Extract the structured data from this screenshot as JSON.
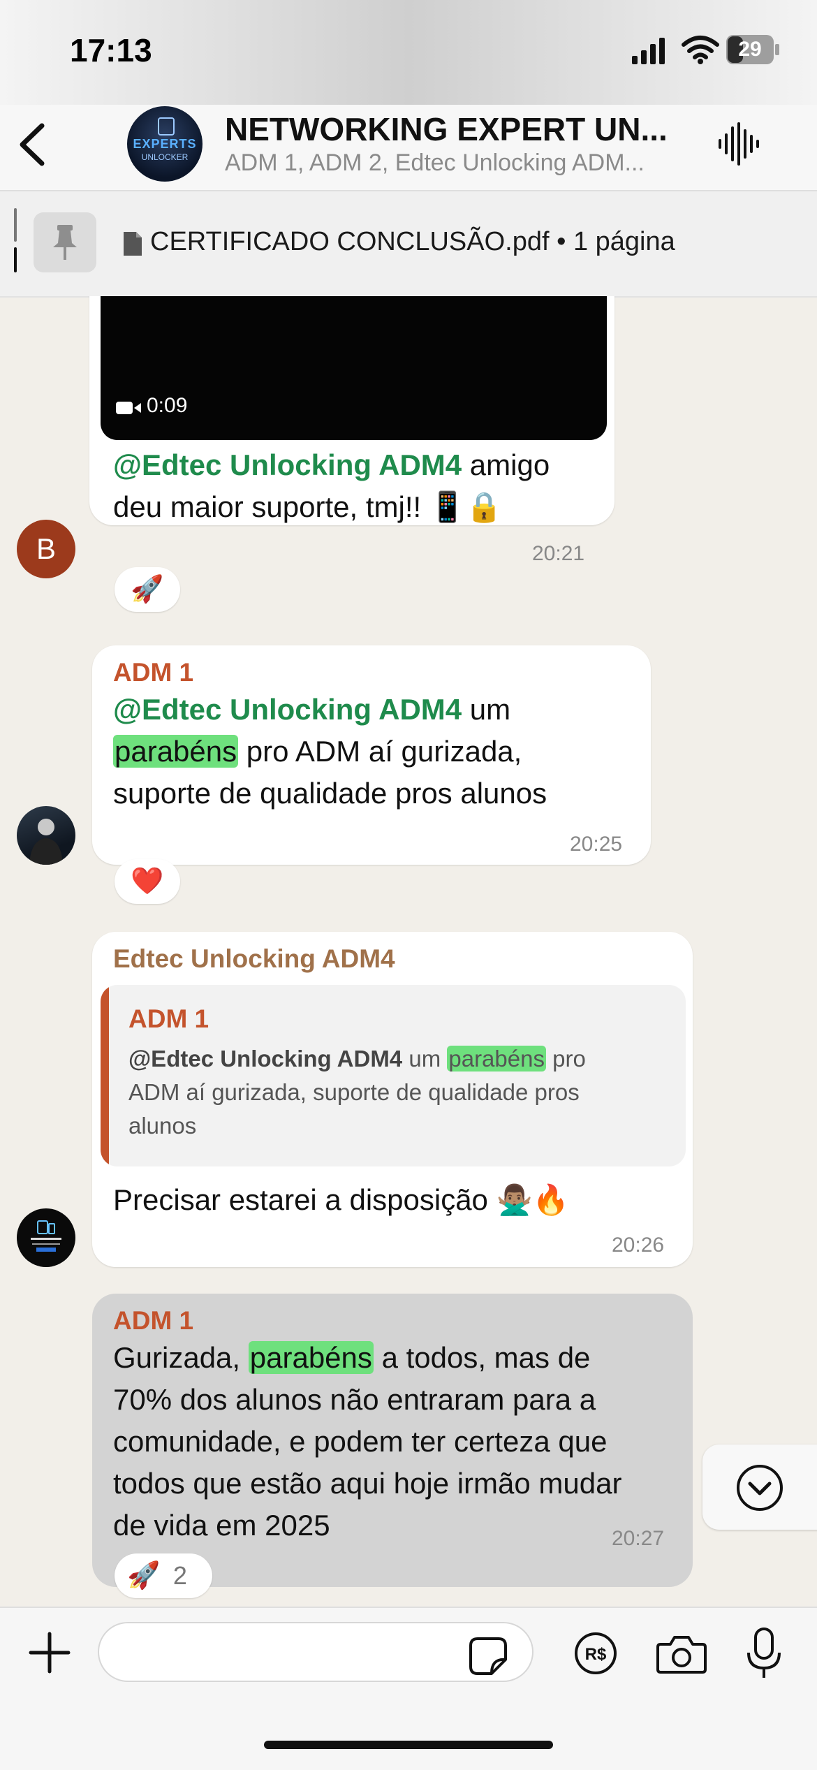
{
  "status_bar": {
    "time": "17:13",
    "battery": "29"
  },
  "header": {
    "title": "NETWORKING EXPERT UN...",
    "subtitle": "ADM 1, ADM 2, Edtec Unlocking ADM...",
    "avatar_line1": "EXPERTS",
    "avatar_line2": "UNLOCKER"
  },
  "pinned": {
    "text": "CERTIFICADO CONCLUSÃO.pdf • 1 página"
  },
  "messages": [
    {
      "video_duration": "0:09",
      "mention": "@Edtec Unlocking ADM4",
      "text_a": " amigo",
      "text_b": "deu maior suporte, tmj!! 📱🔒",
      "time": "20:21",
      "reaction": "🚀",
      "avatar_letter": "B"
    },
    {
      "sender": "ADM 1",
      "mention": "@Edtec Unlocking ADM4",
      "text_a": " um",
      "highlight": "parabéns",
      "text_b": " pro ADM aí gurizada,",
      "text_c": "suporte de qualidade pros alunos",
      "time": "20:25",
      "reaction": "❤️"
    },
    {
      "sender": "Edtec Unlocking ADM4",
      "quote_sender": "ADM 1",
      "quote_mention": "@Edtec Unlocking ADM4",
      "quote_a": " um ",
      "quote_highlight": "parabéns",
      "quote_b": " pro",
      "quote_line2": "ADM aí gurizada, suporte de qualidade pros",
      "quote_line3": "alunos",
      "text": "Precisar estarei a disposição 🙅🏽‍♂️🔥",
      "time": "20:26"
    },
    {
      "sender": "ADM 1",
      "line1_a": "Gurizada, ",
      "highlight": "parabéns",
      "line1_b": " a todos, mas de",
      "line2": "70% dos alunos não entraram para a",
      "line3": "comunidade, e podem ter certeza que",
      "line4": "todos que estão aqui hoje irmão mudar",
      "line5": "de vida em 2025",
      "time": "20:27",
      "reaction": "🚀",
      "reaction_count": "2"
    }
  ],
  "input": {
    "placeholder": ""
  },
  "colors": {
    "mention": "#1f8b4c",
    "highlight": "#6ee07d",
    "adm1": "#c4532c",
    "edtec": "#a0714a",
    "chat_bg": "#f2efe9"
  }
}
